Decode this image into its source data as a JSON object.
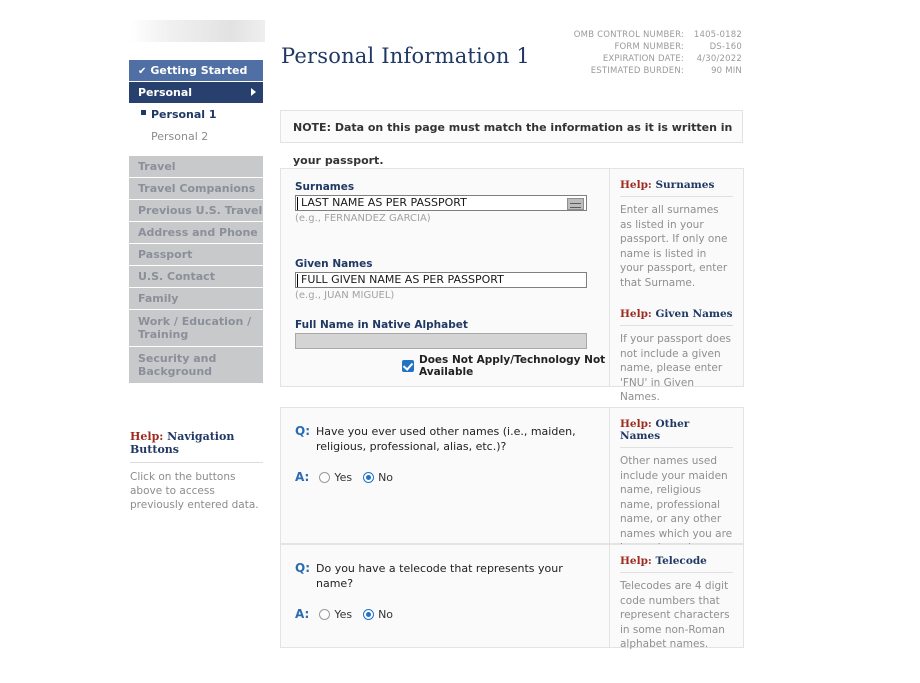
{
  "meta": {
    "rows": [
      {
        "label": "OMB CONTROL NUMBER:",
        "value": "1405-0182"
      },
      {
        "label": "FORM NUMBER:",
        "value": "DS-160"
      },
      {
        "label": "EXPIRATION DATE:",
        "value": "4/30/2022"
      },
      {
        "label": "ESTIMATED BURDEN:",
        "value": "90 MIN"
      }
    ]
  },
  "page": {
    "title": "Personal Information 1",
    "note_label": "NOTE:",
    "note_text": " Data on this page must match the information as it is written in your passport."
  },
  "sidebar": {
    "main_items": [
      {
        "label": "Getting Started",
        "state": "done",
        "check": "✔"
      },
      {
        "label": "Personal",
        "state": "active",
        "arrow": "▶"
      }
    ],
    "sub_items": [
      {
        "label": "Personal 1",
        "current": true
      },
      {
        "label": "Personal 2",
        "current": false
      }
    ],
    "disabled_items": [
      {
        "label": "Travel"
      },
      {
        "label": "Travel Companions"
      },
      {
        "label": "Previous U.S. Travel"
      },
      {
        "label": "Address and Phone"
      },
      {
        "label": "Passport"
      },
      {
        "label": "U.S. Contact"
      },
      {
        "label": "Family"
      },
      {
        "label": "Work / Education / Training"
      },
      {
        "label": "Security and Background"
      }
    ],
    "nav_help": {
      "keyword": "Help:",
      "title": " Navigation Buttons",
      "body": "Click on the buttons above to access previously entered data."
    }
  },
  "form": {
    "surnames": {
      "label": "Surnames",
      "value": "LAST NAME AS PER PASSPORT",
      "hint": "(e.g., FERNANDEZ GARCIA)"
    },
    "given_names": {
      "label": "Given Names",
      "value": "FULL GIVEN NAME AS PER PASSPORT",
      "hint": "(e.g., JUAN MIGUEL)"
    },
    "native_alphabet": {
      "label": "Full Name in Native Alphabet",
      "value": "",
      "checkbox_label": "Does Not Apply/Technology Not Available",
      "checked": true
    },
    "questions": [
      {
        "q_mark": "Q:",
        "a_mark": "A:",
        "question": "Have you ever used other names (i.e., maiden, religious, professional, alias, etc.)?",
        "options": [
          {
            "label": "Yes",
            "selected": false
          },
          {
            "label": "No",
            "selected": true
          }
        ]
      },
      {
        "q_mark": "Q:",
        "a_mark": "A:",
        "question": "Do you have a telecode that represents your name?",
        "options": [
          {
            "label": "Yes",
            "selected": false
          },
          {
            "label": "No",
            "selected": true
          }
        ]
      }
    ]
  },
  "help": {
    "keyword": "Help:",
    "blocks": [
      {
        "title": " Surnames",
        "body": "Enter all surnames as listed in your passport. If only one name is listed in your passport, enter that Surname."
      },
      {
        "title": " Given Names",
        "body": "If your passport does not include a given name, please enter 'FNU' in Given Names."
      },
      {
        "title": " Other Names",
        "body": "Other names used include your maiden name, religious name, professional name, or any other names which you are known by or have been known by in the past."
      },
      {
        "title": " Telecode",
        "body": "Telecodes are 4 digit code numbers that represent characters in some non-Roman alphabet names."
      }
    ]
  },
  "colors": {
    "nav_done": "#4f6fa5",
    "nav_active": "#27406e",
    "nav_disabled": "#c8c9cb",
    "accent_navy": "#1f3864",
    "help_keyword_red": "#9c2a1e",
    "qa_blue": "#2b6cb0",
    "control_blue": "#2272c6"
  }
}
